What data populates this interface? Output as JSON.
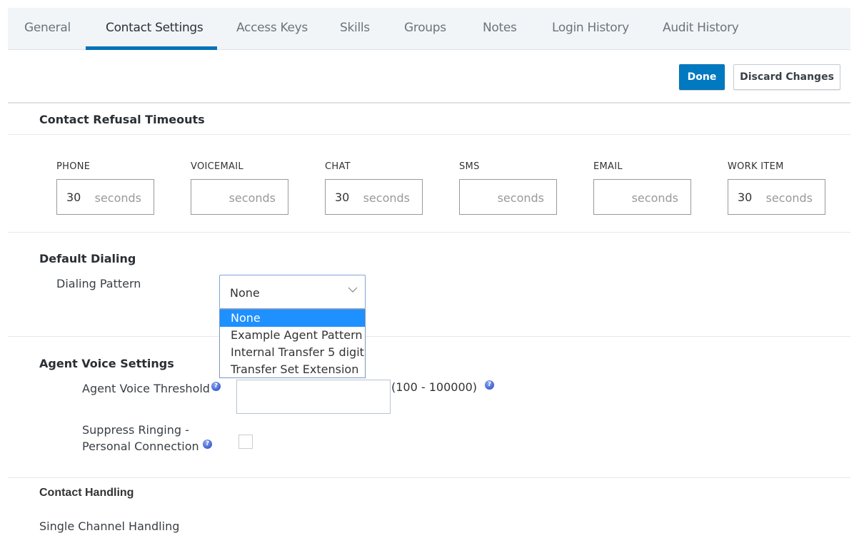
{
  "tabs": [
    {
      "label": "General",
      "active": false
    },
    {
      "label": "Contact Settings",
      "active": true
    },
    {
      "label": "Access Keys",
      "active": false
    },
    {
      "label": "Skills",
      "active": false
    },
    {
      "label": "Groups",
      "active": false
    },
    {
      "label": "Notes",
      "active": false
    },
    {
      "label": "Login History",
      "active": false
    },
    {
      "label": "Audit History",
      "active": false
    }
  ],
  "toolbar": {
    "done_label": "Done",
    "discard_label": "Discard Changes"
  },
  "colors": {
    "accent": "#0079c1",
    "selected_option": "#1e90ff"
  },
  "refusal": {
    "title": "Contact Refusal Timeouts",
    "unit": "seconds",
    "fields": [
      {
        "label": "PHONE",
        "value": "30"
      },
      {
        "label": "VOICEMAIL",
        "value": ""
      },
      {
        "label": "CHAT",
        "value": "30"
      },
      {
        "label": "SMS",
        "value": ""
      },
      {
        "label": "EMAIL",
        "value": ""
      },
      {
        "label": "WORK ITEM",
        "value": "30"
      }
    ]
  },
  "dialing": {
    "title": "Default Dialing",
    "pattern_label": "Dialing Pattern",
    "selected": "None",
    "options": [
      "None",
      "Example Agent Pattern",
      "Internal Transfer 5 digit",
      "Transfer Set Extension"
    ]
  },
  "voice": {
    "title": "Agent Voice Settings",
    "threshold_label": "Agent Voice Threshold",
    "threshold_value": "",
    "threshold_range": "(100 - 100000)",
    "suppress_label_1": "Suppress Ringing -",
    "suppress_label_2": "Personal Connection",
    "suppress_checked": false
  },
  "handling": {
    "title": "Contact Handling",
    "mode": "Single Channel Handling"
  },
  "icons": {
    "help": "help-circle-icon",
    "chevron": "chevron-down-icon",
    "help_glyph": "?"
  }
}
